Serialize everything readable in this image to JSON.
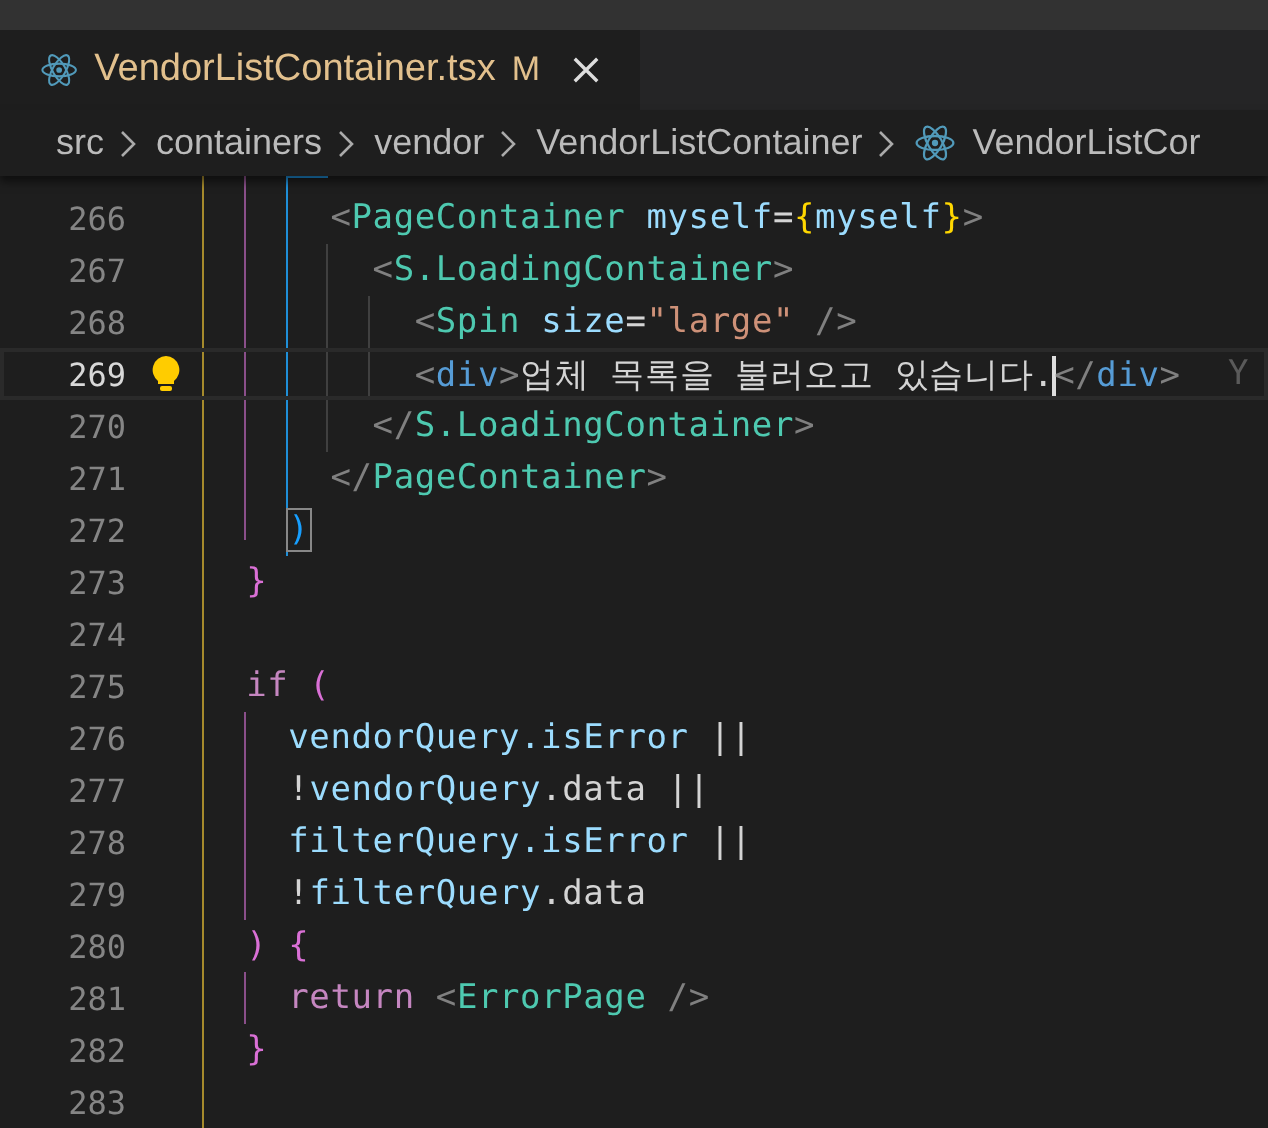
{
  "tabs": [
    {
      "label": "VendorListContainer.tsx",
      "status": "M",
      "selected": true
    }
  ],
  "breadcrumb": [
    {
      "label": "src",
      "icon": false
    },
    {
      "label": "containers",
      "icon": false
    },
    {
      "label": "vendor",
      "icon": false
    },
    {
      "label": "VendorListContainer",
      "icon": false
    },
    {
      "label": "VendorListCor",
      "icon": true
    }
  ],
  "lines": [
    {
      "number": "266",
      "current": false,
      "lightbulb": false,
      "tokens": [
        {
          "kind": "punct",
          "text": "      <"
        },
        {
          "kind": "component",
          "text": "PageContainer"
        },
        {
          "kind": "attr",
          "text": " myself"
        },
        {
          "kind": "text",
          "text": "="
        },
        {
          "kind": "brace",
          "text": "{"
        },
        {
          "kind": "variable",
          "text": "myself"
        },
        {
          "kind": "brace",
          "text": "}"
        },
        {
          "kind": "punct",
          "text": ">"
        }
      ]
    },
    {
      "number": "267",
      "current": false,
      "lightbulb": false,
      "tokens": [
        {
          "kind": "punct",
          "text": "        <"
        },
        {
          "kind": "component",
          "text": "S.LoadingContainer"
        },
        {
          "kind": "punct",
          "text": ">"
        }
      ]
    },
    {
      "number": "268",
      "current": false,
      "lightbulb": false,
      "tokens": [
        {
          "kind": "punct",
          "text": "          <"
        },
        {
          "kind": "component",
          "text": "Spin"
        },
        {
          "kind": "attr",
          "text": " size"
        },
        {
          "kind": "text",
          "text": "="
        },
        {
          "kind": "string",
          "text": "\"large\""
        },
        {
          "kind": "punct",
          "text": " />"
        }
      ]
    },
    {
      "number": "269",
      "current": true,
      "lightbulb": true,
      "blame": "Y",
      "tokens": [
        {
          "kind": "punct",
          "text": "          <"
        },
        {
          "kind": "tag",
          "text": "div"
        },
        {
          "kind": "punct",
          "text": ">"
        },
        {
          "kind": "text",
          "text": "업체 목록을 불러오고 있습니다.",
          "caret": true
        },
        {
          "kind": "punct",
          "text": "</"
        },
        {
          "kind": "tag",
          "text": "div"
        },
        {
          "kind": "punct",
          "text": ">"
        }
      ]
    },
    {
      "number": "270",
      "current": false,
      "lightbulb": false,
      "tokens": [
        {
          "kind": "punct",
          "text": "        </"
        },
        {
          "kind": "component",
          "text": "S.LoadingContainer"
        },
        {
          "kind": "punct",
          "text": ">"
        }
      ]
    },
    {
      "number": "271",
      "current": false,
      "lightbulb": false,
      "tokens": [
        {
          "kind": "punct",
          "text": "      </"
        },
        {
          "kind": "component",
          "text": "PageContainer"
        },
        {
          "kind": "punct",
          "text": ">"
        }
      ]
    },
    {
      "number": "272",
      "current": false,
      "lightbulb": false,
      "tokens": [
        {
          "kind": "paren",
          "text": ")"
        }
      ]
    },
    {
      "number": "273",
      "current": false,
      "lightbulb": false,
      "tokens": [
        {
          "kind": "bracket",
          "text": "  }"
        }
      ]
    },
    {
      "number": "274",
      "current": false,
      "lightbulb": false
    },
    {
      "number": "275",
      "current": false,
      "lightbulb": false,
      "tokens": [
        {
          "kind": "keyword",
          "text": "  if"
        },
        {
          "kind": "bracket",
          "text": " ("
        }
      ]
    },
    {
      "number": "276",
      "current": false,
      "lightbulb": false,
      "tokens": [
        {
          "kind": "variable",
          "text": "    vendorQuery.isError"
        },
        {
          "kind": "text",
          "text": " ||"
        }
      ]
    },
    {
      "number": "277",
      "current": false,
      "lightbulb": false,
      "tokens": [
        {
          "kind": "text",
          "text": "    !"
        },
        {
          "kind": "variable",
          "text": "vendorQuery"
        },
        {
          "kind": "text",
          "text": ".data ||"
        }
      ]
    },
    {
      "number": "278",
      "current": false,
      "lightbulb": false,
      "tokens": [
        {
          "kind": "variable",
          "text": "    filterQuery.isError"
        },
        {
          "kind": "text",
          "text": " ||"
        }
      ]
    },
    {
      "number": "279",
      "current": false,
      "lightbulb": false,
      "tokens": [
        {
          "kind": "text",
          "text": "    !"
        },
        {
          "kind": "variable",
          "text": "filterQuery"
        },
        {
          "kind": "text",
          "text": ".data"
        }
      ]
    },
    {
      "number": "280",
      "current": false,
      "lightbulb": false,
      "tokens": [
        {
          "kind": "bracket",
          "text": "  ) {"
        }
      ]
    },
    {
      "number": "281",
      "current": false,
      "lightbulb": false,
      "tokens": [
        {
          "kind": "keyword",
          "text": "    return"
        },
        {
          "kind": "punct",
          "text": " <"
        },
        {
          "kind": "component",
          "text": "ErrorPage"
        },
        {
          "kind": "punct",
          "text": " />"
        }
      ]
    },
    {
      "number": "282",
      "current": false,
      "lightbulb": false,
      "tokens": [
        {
          "kind": "bracket",
          "text": "  }"
        }
      ]
    },
    {
      "number": "283",
      "current": false,
      "lightbulb": false
    }
  ]
}
